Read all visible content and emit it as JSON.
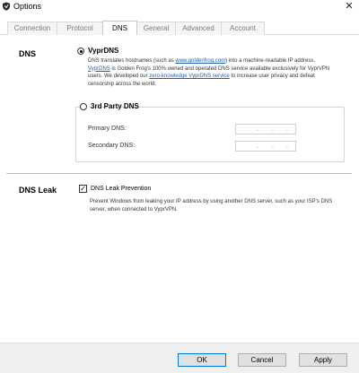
{
  "window": {
    "title": "Options",
    "close_glyph": "✕"
  },
  "tabs": [
    {
      "label": "Connection",
      "active": false
    },
    {
      "label": "Protocol",
      "active": false
    },
    {
      "label": "DNS",
      "active": true
    },
    {
      "label": "General",
      "active": false
    },
    {
      "label": "Advanced",
      "active": false
    },
    {
      "label": "Account",
      "active": false
    }
  ],
  "dns": {
    "section_title": "DNS",
    "vyprdns": {
      "label": "VyprDNS",
      "selected": true,
      "desc_1a": "DNS translates hostnames (such as ",
      "desc_link1": "www.goldenfrog.com",
      "desc_1b": ") into a machine-readable IP address.",
      "desc_link2": "VyprDNS",
      "desc_2": " is Golden Frog's 100% owned and operated DNS service available exclusively for VyprVPN",
      "desc_3a": "users. We developed our ",
      "desc_link3": "zero-knowledge VyprDNS service",
      "desc_3b": " to increase user privacy and defeat",
      "desc_4": "censorship across the world."
    },
    "third_party": {
      "label": "3rd Party DNS",
      "selected": false,
      "primary_label": "Primary DNS:",
      "secondary_label": "Secondary DNS:",
      "ip_dot": "."
    }
  },
  "dns_leak": {
    "section_title": "DNS Leak",
    "checkbox_label": "DNS Leak Prevention",
    "checked": true,
    "check_glyph": "✓",
    "desc_1": "Prevent Windows from leaking your IP address by using another DNS server, such as your ISP's DNS",
    "desc_2": "server, when connected to VyprVPN."
  },
  "buttons": {
    "ok": "OK",
    "cancel": "Cancel",
    "apply": "Apply"
  },
  "colors": {
    "link": "#1a5fb4",
    "button_primary_border": "#0078d7"
  },
  "icons": {
    "app": "vyprvpn-shield-icon",
    "close": "close-icon"
  }
}
